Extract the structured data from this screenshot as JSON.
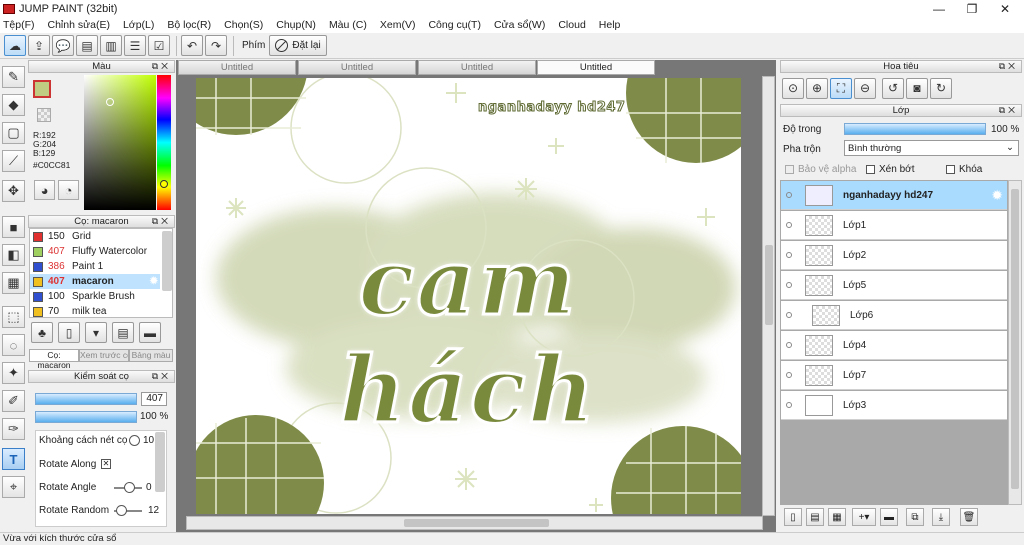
{
  "window": {
    "title": "JUMP PAINT (32bit)"
  },
  "menu": [
    "Tệp(F)",
    "Chỉnh sửa(E)",
    "Lớp(L)",
    "Bộ lọc(R)",
    "Chọn(S)",
    "Chụp(N)",
    "Màu (C)",
    "Xem(V)",
    "Công cụ(T)",
    "Cửa sổ(W)",
    "Cloud",
    "Help"
  ],
  "toolbar": {
    "phim_label": "Phím",
    "reset_label": "Đặt lại"
  },
  "color_panel": {
    "title": "Màu",
    "r": "R:192",
    "g": "G:204",
    "b": "B:129",
    "hex": "#C0CC81",
    "current_color": "#C0CC81"
  },
  "brush_panel": {
    "title": "Cọ: macaron",
    "items": [
      {
        "size": "150",
        "name": "Grid",
        "color": "#e03030"
      },
      {
        "size": "407",
        "name": "Fluffy Watercolor",
        "color": "#a0d060"
      },
      {
        "size": "386",
        "name": "Paint 1",
        "color": "#3050d0"
      },
      {
        "size": "407",
        "name": "macaron",
        "color": "#f0c020"
      },
      {
        "size": "100",
        "name": "Sparkle Brush",
        "color": "#3050d0"
      },
      {
        "size": "70",
        "name": "milk tea",
        "color": "#f0c020"
      }
    ],
    "tabs": [
      "Cọ: macaron",
      "Xem trước cọ",
      "Bảng màu"
    ]
  },
  "brush_control": {
    "title": "Kiểm soát cọ",
    "size_value": "407",
    "opacity_value": "100 %",
    "spacing_label": "Khoảng cách nét cọ",
    "spacing_value": "10",
    "rotate_along_label": "Rotate Along",
    "rotate_angle_label": "Rotate Angle",
    "rotate_angle_value": "0",
    "rotate_random_label": "Rotate Random",
    "rotate_random_value": "12"
  },
  "tabs": [
    "Untitled",
    "Untitled",
    "Untitled",
    "Untitled"
  ],
  "artwork": {
    "title_text": "cam hách",
    "watermark": "nganhadayy hd247"
  },
  "navigator": {
    "title": "Hoa tiêu"
  },
  "layer_panel": {
    "title": "Lớp",
    "opacity_label": "Độ trong",
    "opacity_value": "100 %",
    "blend_label": "Pha trộn",
    "blend_value": "Bình thường",
    "protect_alpha": "Bảo vệ alpha",
    "clipping": "Xén bớt",
    "lock": "Khóa",
    "layers": [
      "nganhadayy hd247",
      "Lớp1",
      "Lớp2",
      "Lớp5",
      "Lớp6",
      "Lớp4",
      "Lớp7",
      "Lớp3"
    ]
  },
  "status": {
    "text": "Vừa với kích thước cửa sổ"
  }
}
